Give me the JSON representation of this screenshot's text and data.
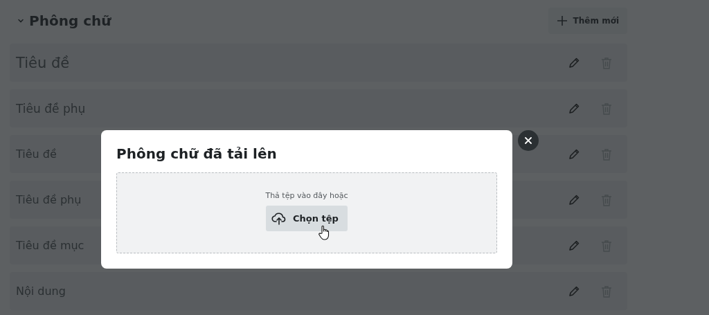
{
  "section": {
    "title": "Phông chữ",
    "expanded": true,
    "add_button": "Thêm mới"
  },
  "font_rows": [
    {
      "label": "Tiêu đề",
      "kind": "title"
    },
    {
      "label": "Tiêu đề phụ",
      "kind": "subtitle"
    },
    {
      "label": "Tiêu đề",
      "kind": "normal"
    },
    {
      "label": "Tiêu đề phụ",
      "kind": "normal"
    },
    {
      "label": "Tiêu đề mục",
      "kind": "normal"
    },
    {
      "label": "Nội dung",
      "kind": "normal"
    }
  ],
  "dialog": {
    "title": "Phông chữ đã tải lên",
    "drop_hint": "Thả tệp vào đây hoặc",
    "choose_button": "Chọn tệp"
  }
}
